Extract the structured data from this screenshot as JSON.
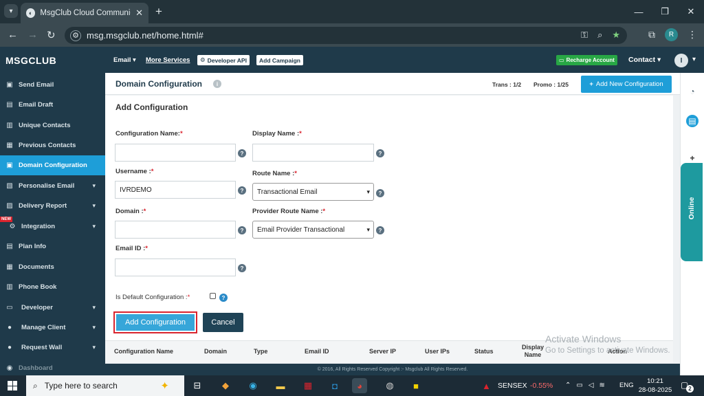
{
  "browser": {
    "tab_title": "MsgClub Cloud Communication",
    "url": "msg.msgclub.net/home.html#",
    "profile_initial": "R"
  },
  "header": {
    "brand": "MSGCLUB",
    "email_menu": "Email",
    "more_services": "More Services",
    "developer_api": "Developer API",
    "add_campaign": "Add Campaign",
    "recharge": "Recharge Account",
    "contact": "Contact",
    "user_initial": "I"
  },
  "sidebar": {
    "items": [
      {
        "label": "Send Email",
        "icon": "send-icon"
      },
      {
        "label": "Email Draft",
        "icon": "draft-icon"
      },
      {
        "label": "Unique Contacts",
        "icon": "contacts-icon"
      },
      {
        "label": "Previous Contacts",
        "icon": "history-icon"
      },
      {
        "label": "Domain Configuration",
        "icon": "domain-icon"
      },
      {
        "label": "Personalise Email",
        "icon": "personalise-icon"
      },
      {
        "label": "Delivery Report",
        "icon": "report-icon"
      },
      {
        "label": "Integration",
        "icon": "integration-icon"
      },
      {
        "label": "Plan Info",
        "icon": "plan-icon"
      },
      {
        "label": "Documents",
        "icon": "documents-icon"
      },
      {
        "label": "Phone Book",
        "icon": "phonebook-icon"
      },
      {
        "label": "Developer",
        "icon": "developer-icon"
      },
      {
        "label": "Manage Client",
        "icon": "client-icon"
      },
      {
        "label": "Request Wall",
        "icon": "request-icon"
      },
      {
        "label": "Dashboard",
        "icon": "dashboard-icon"
      }
    ],
    "new_badge": "NEW"
  },
  "page": {
    "title": "Domain Configuration",
    "trans": "Trans : 1/2",
    "promo": "Promo : 1/25",
    "add_new_button": "Add New Configuration"
  },
  "form": {
    "title": "Add Configuration",
    "config_name_label": "Configuration Name:",
    "display_name_label": "Display Name :",
    "username_label": "Username :",
    "username_value": "IVRDEMO",
    "route_name_label": "Route Name :",
    "route_name_value": "Transactional Email",
    "domain_label": "Domain :",
    "provider_route_label": "Provider Route Name :",
    "provider_route_value": "Email Provider Transactional",
    "email_id_label": "Email ID :",
    "default_config_label": "Is Default Configuration :",
    "required_mark": "*",
    "add_button": "Add Configuration",
    "cancel_button": "Cancel"
  },
  "table": {
    "headers": [
      "Configuration Name",
      "Domain",
      "Type",
      "Email ID",
      "Server IP",
      "User IPs",
      "Status",
      "Display Name",
      "Action"
    ]
  },
  "footer": {
    "copyright": "© 2016, All Rights Reserved Copyright :- Msgclub All Rights Reserved."
  },
  "rail": {
    "online": "Online"
  },
  "watermark": {
    "line1": "Activate Windows",
    "line2": "Go to Settings to activate Windows."
  },
  "taskbar": {
    "search_placeholder": "Type here to search",
    "sensex_label": "SENSEX",
    "sensex_value": "-0.55%",
    "language": "ENG",
    "time": "10:21",
    "date": "28-08-2025",
    "notifications": "2"
  },
  "colors": {
    "brand_dark": "#1f3a4a",
    "accent": "#1e9ed8",
    "recharge_green": "#28a745",
    "required_red": "#d9232d"
  }
}
